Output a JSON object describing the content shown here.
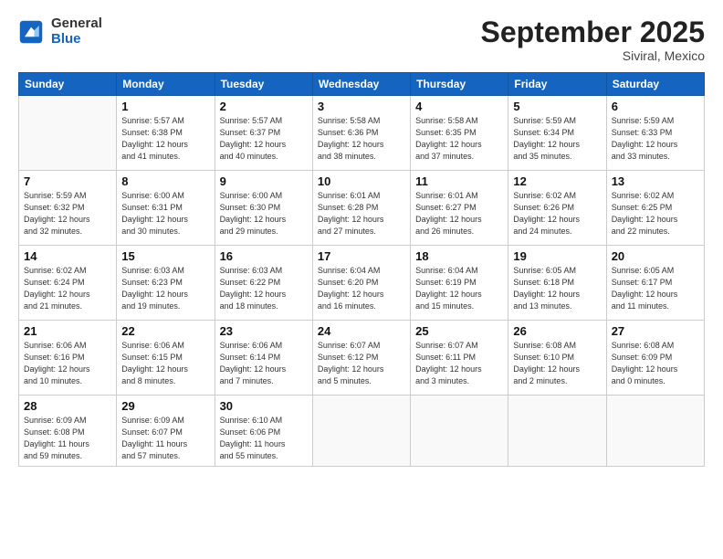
{
  "logo": {
    "line1": "General",
    "line2": "Blue"
  },
  "title": "September 2025",
  "location": "Siviral, Mexico",
  "days_of_week": [
    "Sunday",
    "Monday",
    "Tuesday",
    "Wednesday",
    "Thursday",
    "Friday",
    "Saturday"
  ],
  "weeks": [
    [
      {
        "num": "",
        "sunrise": "",
        "sunset": "",
        "daylight": "",
        "empty": true
      },
      {
        "num": "1",
        "sunrise": "Sunrise: 5:57 AM",
        "sunset": "Sunset: 6:38 PM",
        "daylight": "Daylight: 12 hours and 41 minutes.",
        "empty": false
      },
      {
        "num": "2",
        "sunrise": "Sunrise: 5:57 AM",
        "sunset": "Sunset: 6:37 PM",
        "daylight": "Daylight: 12 hours and 40 minutes.",
        "empty": false
      },
      {
        "num": "3",
        "sunrise": "Sunrise: 5:58 AM",
        "sunset": "Sunset: 6:36 PM",
        "daylight": "Daylight: 12 hours and 38 minutes.",
        "empty": false
      },
      {
        "num": "4",
        "sunrise": "Sunrise: 5:58 AM",
        "sunset": "Sunset: 6:35 PM",
        "daylight": "Daylight: 12 hours and 37 minutes.",
        "empty": false
      },
      {
        "num": "5",
        "sunrise": "Sunrise: 5:59 AM",
        "sunset": "Sunset: 6:34 PM",
        "daylight": "Daylight: 12 hours and 35 minutes.",
        "empty": false
      },
      {
        "num": "6",
        "sunrise": "Sunrise: 5:59 AM",
        "sunset": "Sunset: 6:33 PM",
        "daylight": "Daylight: 12 hours and 33 minutes.",
        "empty": false
      }
    ],
    [
      {
        "num": "7",
        "sunrise": "Sunrise: 5:59 AM",
        "sunset": "Sunset: 6:32 PM",
        "daylight": "Daylight: 12 hours and 32 minutes.",
        "empty": false
      },
      {
        "num": "8",
        "sunrise": "Sunrise: 6:00 AM",
        "sunset": "Sunset: 6:31 PM",
        "daylight": "Daylight: 12 hours and 30 minutes.",
        "empty": false
      },
      {
        "num": "9",
        "sunrise": "Sunrise: 6:00 AM",
        "sunset": "Sunset: 6:30 PM",
        "daylight": "Daylight: 12 hours and 29 minutes.",
        "empty": false
      },
      {
        "num": "10",
        "sunrise": "Sunrise: 6:01 AM",
        "sunset": "Sunset: 6:28 PM",
        "daylight": "Daylight: 12 hours and 27 minutes.",
        "empty": false
      },
      {
        "num": "11",
        "sunrise": "Sunrise: 6:01 AM",
        "sunset": "Sunset: 6:27 PM",
        "daylight": "Daylight: 12 hours and 26 minutes.",
        "empty": false
      },
      {
        "num": "12",
        "sunrise": "Sunrise: 6:02 AM",
        "sunset": "Sunset: 6:26 PM",
        "daylight": "Daylight: 12 hours and 24 minutes.",
        "empty": false
      },
      {
        "num": "13",
        "sunrise": "Sunrise: 6:02 AM",
        "sunset": "Sunset: 6:25 PM",
        "daylight": "Daylight: 12 hours and 22 minutes.",
        "empty": false
      }
    ],
    [
      {
        "num": "14",
        "sunrise": "Sunrise: 6:02 AM",
        "sunset": "Sunset: 6:24 PM",
        "daylight": "Daylight: 12 hours and 21 minutes.",
        "empty": false
      },
      {
        "num": "15",
        "sunrise": "Sunrise: 6:03 AM",
        "sunset": "Sunset: 6:23 PM",
        "daylight": "Daylight: 12 hours and 19 minutes.",
        "empty": false
      },
      {
        "num": "16",
        "sunrise": "Sunrise: 6:03 AM",
        "sunset": "Sunset: 6:22 PM",
        "daylight": "Daylight: 12 hours and 18 minutes.",
        "empty": false
      },
      {
        "num": "17",
        "sunrise": "Sunrise: 6:04 AM",
        "sunset": "Sunset: 6:20 PM",
        "daylight": "Daylight: 12 hours and 16 minutes.",
        "empty": false
      },
      {
        "num": "18",
        "sunrise": "Sunrise: 6:04 AM",
        "sunset": "Sunset: 6:19 PM",
        "daylight": "Daylight: 12 hours and 15 minutes.",
        "empty": false
      },
      {
        "num": "19",
        "sunrise": "Sunrise: 6:05 AM",
        "sunset": "Sunset: 6:18 PM",
        "daylight": "Daylight: 12 hours and 13 minutes.",
        "empty": false
      },
      {
        "num": "20",
        "sunrise": "Sunrise: 6:05 AM",
        "sunset": "Sunset: 6:17 PM",
        "daylight": "Daylight: 12 hours and 11 minutes.",
        "empty": false
      }
    ],
    [
      {
        "num": "21",
        "sunrise": "Sunrise: 6:06 AM",
        "sunset": "Sunset: 6:16 PM",
        "daylight": "Daylight: 12 hours and 10 minutes.",
        "empty": false
      },
      {
        "num": "22",
        "sunrise": "Sunrise: 6:06 AM",
        "sunset": "Sunset: 6:15 PM",
        "daylight": "Daylight: 12 hours and 8 minutes.",
        "empty": false
      },
      {
        "num": "23",
        "sunrise": "Sunrise: 6:06 AM",
        "sunset": "Sunset: 6:14 PM",
        "daylight": "Daylight: 12 hours and 7 minutes.",
        "empty": false
      },
      {
        "num": "24",
        "sunrise": "Sunrise: 6:07 AM",
        "sunset": "Sunset: 6:12 PM",
        "daylight": "Daylight: 12 hours and 5 minutes.",
        "empty": false
      },
      {
        "num": "25",
        "sunrise": "Sunrise: 6:07 AM",
        "sunset": "Sunset: 6:11 PM",
        "daylight": "Daylight: 12 hours and 3 minutes.",
        "empty": false
      },
      {
        "num": "26",
        "sunrise": "Sunrise: 6:08 AM",
        "sunset": "Sunset: 6:10 PM",
        "daylight": "Daylight: 12 hours and 2 minutes.",
        "empty": false
      },
      {
        "num": "27",
        "sunrise": "Sunrise: 6:08 AM",
        "sunset": "Sunset: 6:09 PM",
        "daylight": "Daylight: 12 hours and 0 minutes.",
        "empty": false
      }
    ],
    [
      {
        "num": "28",
        "sunrise": "Sunrise: 6:09 AM",
        "sunset": "Sunset: 6:08 PM",
        "daylight": "Daylight: 11 hours and 59 minutes.",
        "empty": false
      },
      {
        "num": "29",
        "sunrise": "Sunrise: 6:09 AM",
        "sunset": "Sunset: 6:07 PM",
        "daylight": "Daylight: 11 hours and 57 minutes.",
        "empty": false
      },
      {
        "num": "30",
        "sunrise": "Sunrise: 6:10 AM",
        "sunset": "Sunset: 6:06 PM",
        "daylight": "Daylight: 11 hours and 55 minutes.",
        "empty": false
      },
      {
        "num": "",
        "sunrise": "",
        "sunset": "",
        "daylight": "",
        "empty": true
      },
      {
        "num": "",
        "sunrise": "",
        "sunset": "",
        "daylight": "",
        "empty": true
      },
      {
        "num": "",
        "sunrise": "",
        "sunset": "",
        "daylight": "",
        "empty": true
      },
      {
        "num": "",
        "sunrise": "",
        "sunset": "",
        "daylight": "",
        "empty": true
      }
    ]
  ]
}
